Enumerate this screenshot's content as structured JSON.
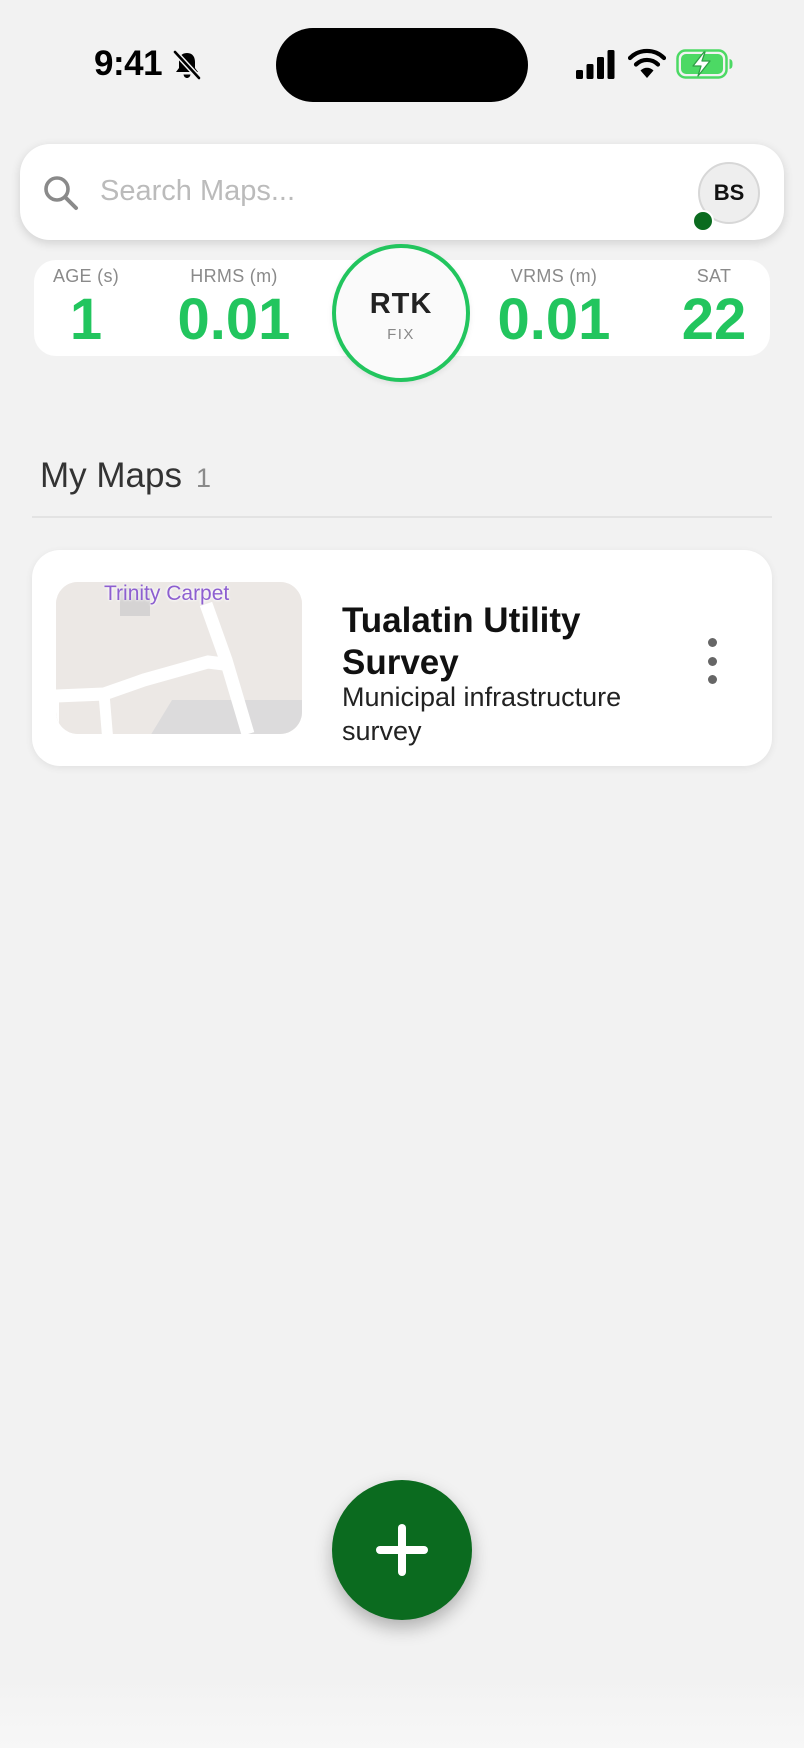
{
  "status_bar": {
    "time": "9:41"
  },
  "search": {
    "placeholder": "Search Maps...",
    "value": "",
    "avatar_initials": "BS"
  },
  "gnss": {
    "age": {
      "label": "AGE (s)",
      "value": "1"
    },
    "hrms": {
      "label": "HRMS (m)",
      "value": "0.01"
    },
    "vrms": {
      "label": "VRMS (m)",
      "value": "0.01"
    },
    "sat": {
      "label": "SAT",
      "value": "22"
    },
    "fix": {
      "title": "RTK",
      "subtitle": "FIX"
    }
  },
  "maps_section": {
    "title": "My Maps",
    "count": "1"
  },
  "maps": [
    {
      "title": "Tualatin Utility Survey",
      "description": "Municipal infrastructure survey",
      "thumbnail_label": "Trinity Carpet"
    }
  ],
  "icons": {
    "search": "search-icon",
    "bell_off": "bell-off-icon",
    "signal": "cellular-signal-icon",
    "wifi": "wifi-icon",
    "battery": "battery-charging-icon",
    "more": "more-vertical-icon",
    "add": "plus-icon"
  },
  "colors": {
    "accent_green": "#22c55e",
    "fab_green": "#0b6b1f",
    "online_dot": "#0b6b1f",
    "battery_green": "#4cd964",
    "thumbnail_label": "#8d5fd0"
  }
}
